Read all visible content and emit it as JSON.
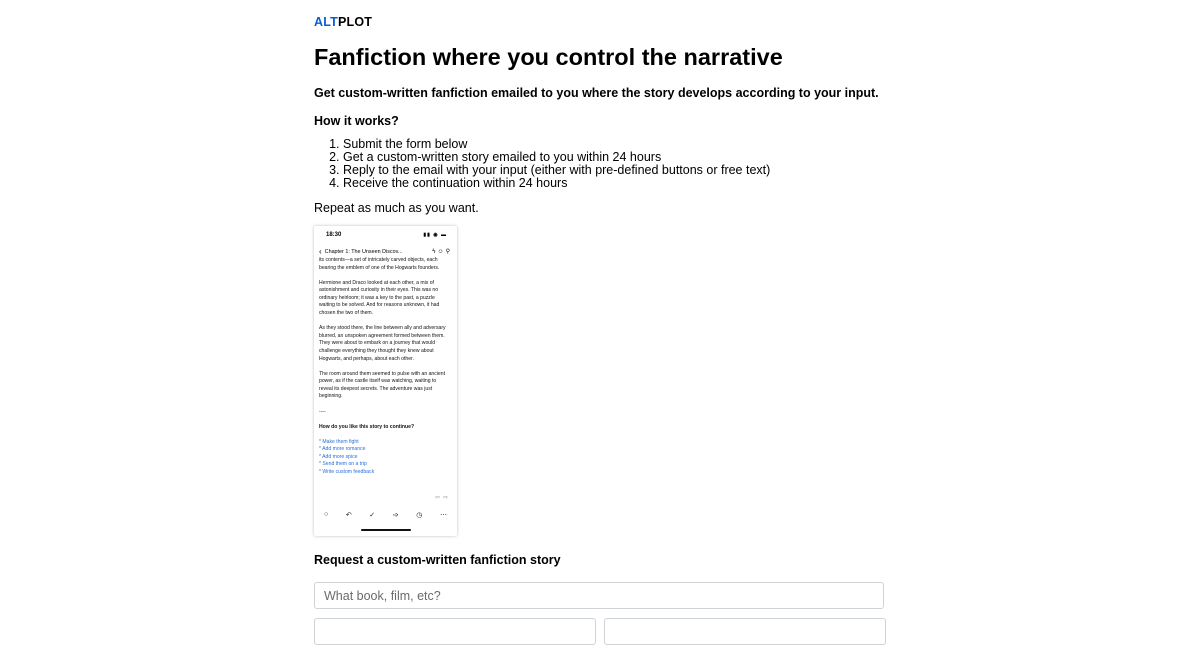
{
  "brand": {
    "alt": "ALT",
    "plot": "PLOT",
    "accent": "#0a5cd5"
  },
  "hero": {
    "title": "Fanfiction where you control the narrative",
    "subtitle": "Get custom-written fanfiction emailed to you where the story develops according to your input."
  },
  "how": {
    "heading": "How it works?",
    "steps": [
      "Submit the form below",
      "Get a custom-written story emailed to you within 24 hours",
      "Reply to the email with your input (either with pre-defined buttons or free text)",
      "Receive the continuation within 24 hours"
    ],
    "repeat": "Repeat as much as you want."
  },
  "phone": {
    "time": "18:30",
    "chapter": "Chapter 1: The Unseen Discov...",
    "paragraphs": [
      "its contents—a set of intricately carved objects, each bearing the emblem of one of the Hogwarts founders.",
      "Hermione and Draco looked at each other, a mix of astonishment and curiosity in their eyes. This was no ordinary heirloom; it was a key to the past, a puzzle waiting to be solved. And for reasons unknown, it had chosen the two of them.",
      "As they stood there, the line between ally and adversary blurred, an unspoken agreement formed between them. They were about to embark on a journey that would challenge everything they thought they knew about Hogwarts, and perhaps, about each other.",
      "The room around them seemed to pulse with an ancient power, as if the castle itself was watching, waiting to reveal its deepest secrets. The adventure was just beginning.",
      "----"
    ],
    "question": "How do you like this story to continue?",
    "options": [
      "* Make them fight",
      "* Add more romance",
      "* Add more spice",
      "* Send them on a trip",
      "* Write custom feedback"
    ]
  },
  "form": {
    "heading": "Request a custom-written fanfiction story",
    "source_placeholder": "What book, film, etc?"
  }
}
